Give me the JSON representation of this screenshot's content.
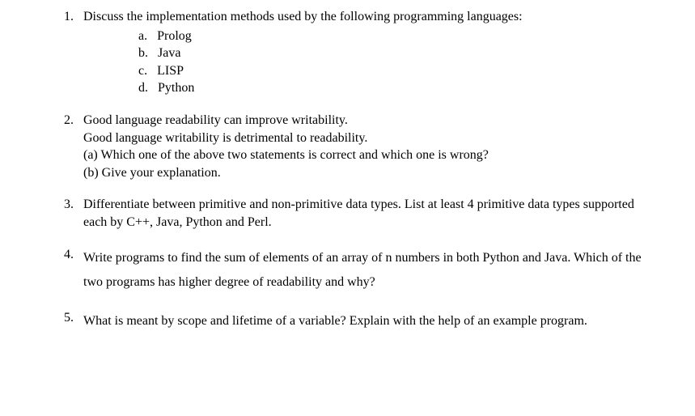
{
  "questions": [
    {
      "num": "1.",
      "prompt": "Discuss the implementation methods used by the following programming languages:",
      "subs": [
        {
          "letter": "a.",
          "text": "Prolog"
        },
        {
          "letter": "b.",
          "text": "Java"
        },
        {
          "letter": "c.",
          "text": "LISP"
        },
        {
          "letter": "d.",
          "text": "Python"
        }
      ]
    },
    {
      "num": "2.",
      "lines": [
        "Good language readability can improve writability.",
        "Good language writability is detrimental to readability.",
        "(a) Which one of the above two statements is correct and which one is wrong?",
        "(b) Give your explanation."
      ]
    },
    {
      "num": "3.",
      "lines": [
        "Differentiate between primitive and non-primitive data types. List at least 4 primitive data types supported each by C++, Java, Python and Perl."
      ]
    },
    {
      "num": "4.",
      "lines": [
        "Write  programs to find the sum of elements of an array of n numbers in both Python and Java. Which of the two programs has higher degree of readability and why?"
      ]
    },
    {
      "num": "5.",
      "lines": [
        "What is meant by scope and lifetime of a variable? Explain with the help of an example program."
      ]
    }
  ]
}
